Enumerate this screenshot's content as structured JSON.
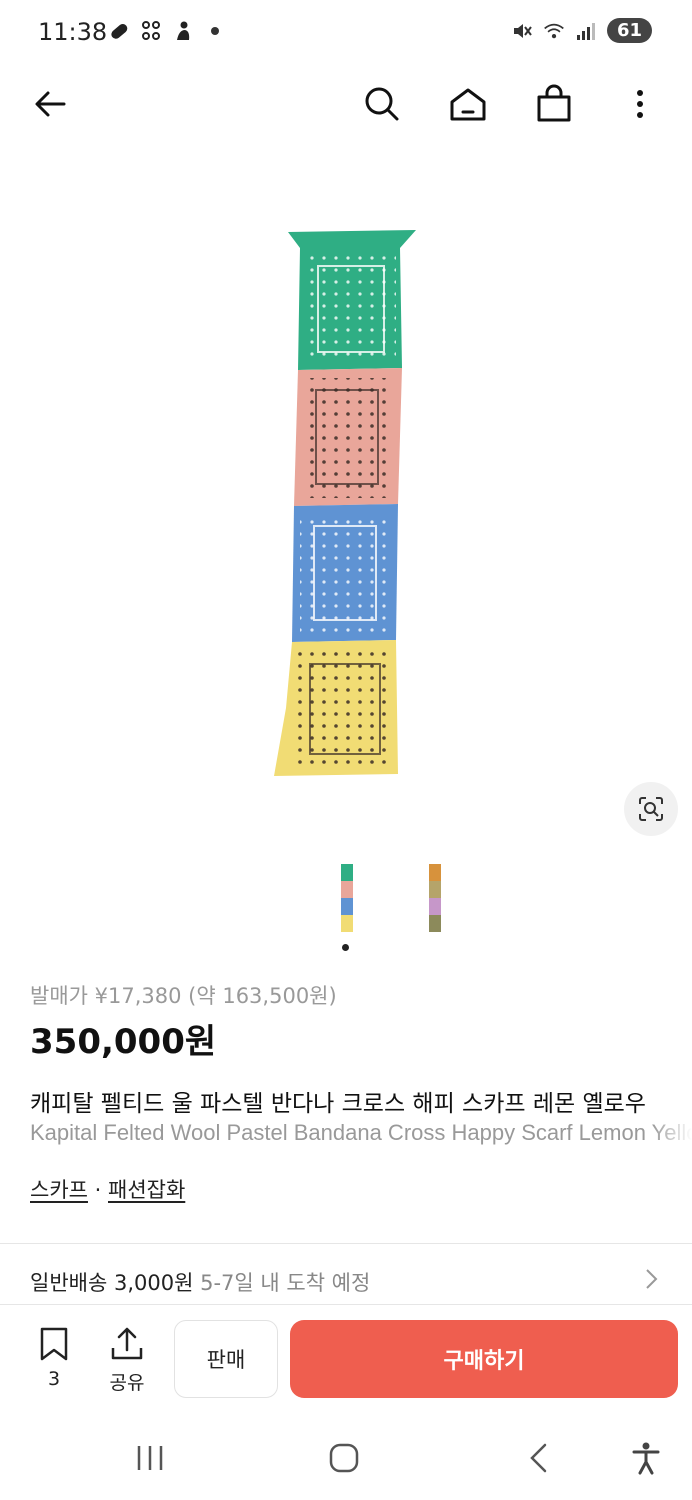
{
  "status_bar": {
    "time": "11:38",
    "battery": "61",
    "icons": [
      "pill-icon",
      "grid-icon",
      "person-icon",
      "dot-icon",
      "mute-icon",
      "wifi-icon",
      "signal-icon"
    ]
  },
  "nav": {
    "icons": [
      "back-arrow-icon",
      "search-icon",
      "home-icon",
      "shopping-bag-icon",
      "more-vertical-icon"
    ]
  },
  "product": {
    "release_price": "발매가 ¥17,380 (약 163,500원)",
    "price": "350,000원",
    "title_ko": "캐피탈 펠티드 울 파스텔 반다나 크로스 해피 스카프 레몬 옐로우",
    "title_en": "Kapital Felted Wool Pastel Bandana Cross Happy Scarf Lemon Yellow",
    "category_primary": "스카프",
    "category_separator": " · ",
    "category_secondary": "패션잡화",
    "image_count": 2,
    "active_image": 1
  },
  "shipping": {
    "main": "일반배송 3,000원",
    "sub": " 5-7일 내 도착 예정"
  },
  "actions": {
    "bookmark_count": "3",
    "share_label": "공유",
    "sell_label": "판매",
    "buy_label": "구매하기"
  },
  "colors": {
    "accent": "#ef5e4f",
    "scarf_green": "#2fae84",
    "scarf_pink": "#e9a69a",
    "scarf_blue": "#5f93d3",
    "scarf_yellow": "#f1dc74"
  }
}
